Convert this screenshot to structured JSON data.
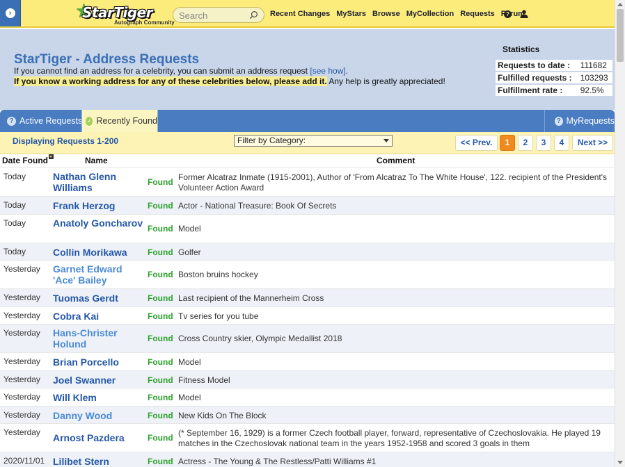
{
  "brand": {
    "logo_text": "StarTiger",
    "logo_sub": "Autograph Community",
    "color": "#fcec7c"
  },
  "search": {
    "placeholder": "Search"
  },
  "nav": [
    "Recent Changes",
    "MyStars",
    "Browse",
    "MyCollection",
    "Requests",
    "Forum"
  ],
  "header": {
    "title": "StarTiger - Address Requests",
    "intro_line1": "If you cannot find an address for a celebrity, you can submit an address request ",
    "see_how": "[see how]",
    "intro_line1_end": ".",
    "intro_line2_bold": "If you know a working address for any of these celebrities below, please add it.",
    "intro_line2_rest": " Any help is greatly appreciated!"
  },
  "statistics": {
    "title": "Statistics",
    "rows": [
      {
        "label": "Requests to date :",
        "value": "111682"
      },
      {
        "label": "Fulfilled requests :",
        "value": "103293"
      },
      {
        "label": "Fulfillment rate :",
        "value": "92.5%"
      }
    ]
  },
  "tabs": {
    "active": "Active Requests",
    "found": "Recently Found",
    "my": "MyRequests"
  },
  "controls": {
    "displaying": "Displaying Requests 1-200",
    "filter_label": "Filter by Category:",
    "prev": "<< Prev.",
    "pages": [
      "1",
      "2",
      "3",
      "4"
    ],
    "current_page": "1",
    "next": "Next >>"
  },
  "table": {
    "headers": {
      "date": "Date Found",
      "name": "Name",
      "comment": "Comment"
    },
    "rows": [
      {
        "date": "Today",
        "name": "Nathan Glenn Williams",
        "status": "Found",
        "comment": "Former Alcatraz Inmate (1915-2001), Author of 'From Alcatraz To The White House', 122. recipient of the President's Volunteer Action Award"
      },
      {
        "date": "Today",
        "name": "Frank Herzog",
        "status": "Found",
        "comment": "Actor - National Treasure: Book Of Secrets"
      },
      {
        "date": "Today",
        "name": "Anatoly Goncharov",
        "status": "Found",
        "comment": "Model"
      },
      {
        "date": "Today",
        "name": "Collin Morikawa",
        "status": "Found",
        "comment": "Golfer"
      },
      {
        "date": "Yesterday",
        "name": "Garnet Edward 'Ace' Bailey",
        "status": "Found",
        "comment": "Boston bruins hockey"
      },
      {
        "date": "Yesterday",
        "name": "Tuomas Gerdt",
        "status": "Found",
        "comment": "Last recipient of the Mannerheim Cross"
      },
      {
        "date": "Yesterday",
        "name": "Cobra Kai",
        "status": "Found",
        "comment": "Tv series for you tube"
      },
      {
        "date": "Yesterday",
        "name": "Hans-Christer Holund",
        "status": "Found",
        "comment": "Cross Country skier, Olympic Medallist 2018"
      },
      {
        "date": "Yesterday",
        "name": "Brian Porcello",
        "status": "Found",
        "comment": "Model"
      },
      {
        "date": "Yesterday",
        "name": "Joel Swanner",
        "status": "Found",
        "comment": "Fitness Model"
      },
      {
        "date": "Yesterday",
        "name": "Will Klem",
        "status": "Found",
        "comment": "Model"
      },
      {
        "date": "Yesterday",
        "name": "Danny Wood",
        "status": "Found",
        "comment": "New Kids On The Block"
      },
      {
        "date": "Yesterday",
        "name": "Arnost Pazdera",
        "status": "Found",
        "comment": "(* September 16, 1929) is a former Czech football player, forward, representative of Czechoslovakia. He played 19 matches in the Czechoslovak national team in the years 1952-1958 and scored 3 goals in them"
      },
      {
        "date": "2020/11/01",
        "name": "Lilibet Stern",
        "status": "Found",
        "comment": "Actress - The Young & The Restless/Patti Williams #1"
      }
    ]
  },
  "colors": {
    "accent": "#3a6fb5",
    "found": "#2ea12e",
    "current_page": "#f08a1e",
    "header_bg": "#c9d6e9"
  }
}
